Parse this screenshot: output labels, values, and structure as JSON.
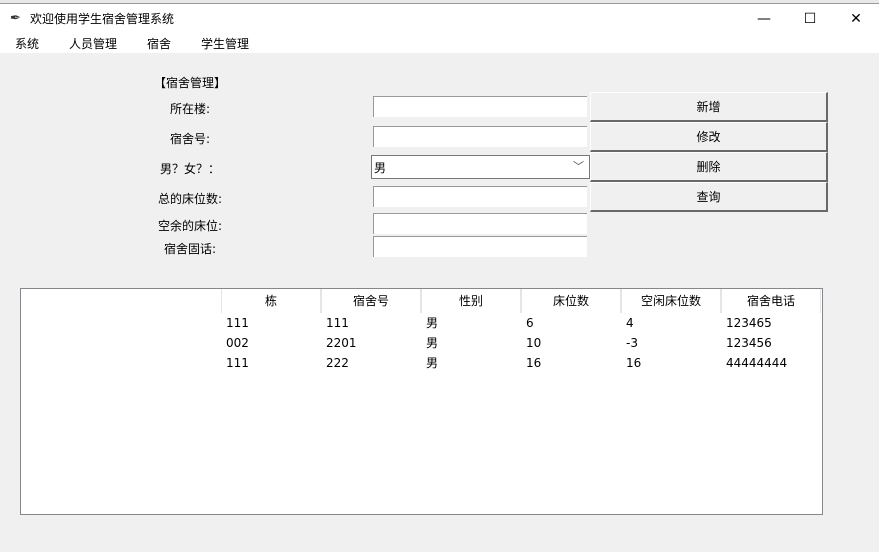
{
  "window": {
    "title": "欢迎使用学生宿舍管理系统",
    "icon": "feather-icon",
    "controls": [
      "minimize",
      "maximize",
      "close"
    ]
  },
  "menu": [
    "系统",
    "人员管理",
    "宿舍",
    "学生管理"
  ],
  "form": {
    "section_title": "【宿舍管理】",
    "labels": [
      "所在楼:",
      "宿舍号:",
      "男？女？：",
      "总的床位数:",
      "空余的床位:",
      "宿舍固话:"
    ],
    "building": "",
    "room": "",
    "gender": "男",
    "total_beds": "",
    "free_beds": "",
    "phone": ""
  },
  "buttons": [
    "新增",
    "修改",
    "删除",
    "查询"
  ],
  "table": {
    "columns": [
      "栋",
      "宿舍号",
      "性别",
      "床位数",
      "空闲床位数",
      "宿舍电话"
    ],
    "rows": [
      [
        "111",
        "111",
        "男",
        "6",
        "4",
        "123465"
      ],
      [
        "002",
        "2201",
        "男",
        "10",
        "-3",
        "123456"
      ],
      [
        "111",
        "222",
        "男",
        "16",
        "16",
        "44444444"
      ]
    ]
  }
}
